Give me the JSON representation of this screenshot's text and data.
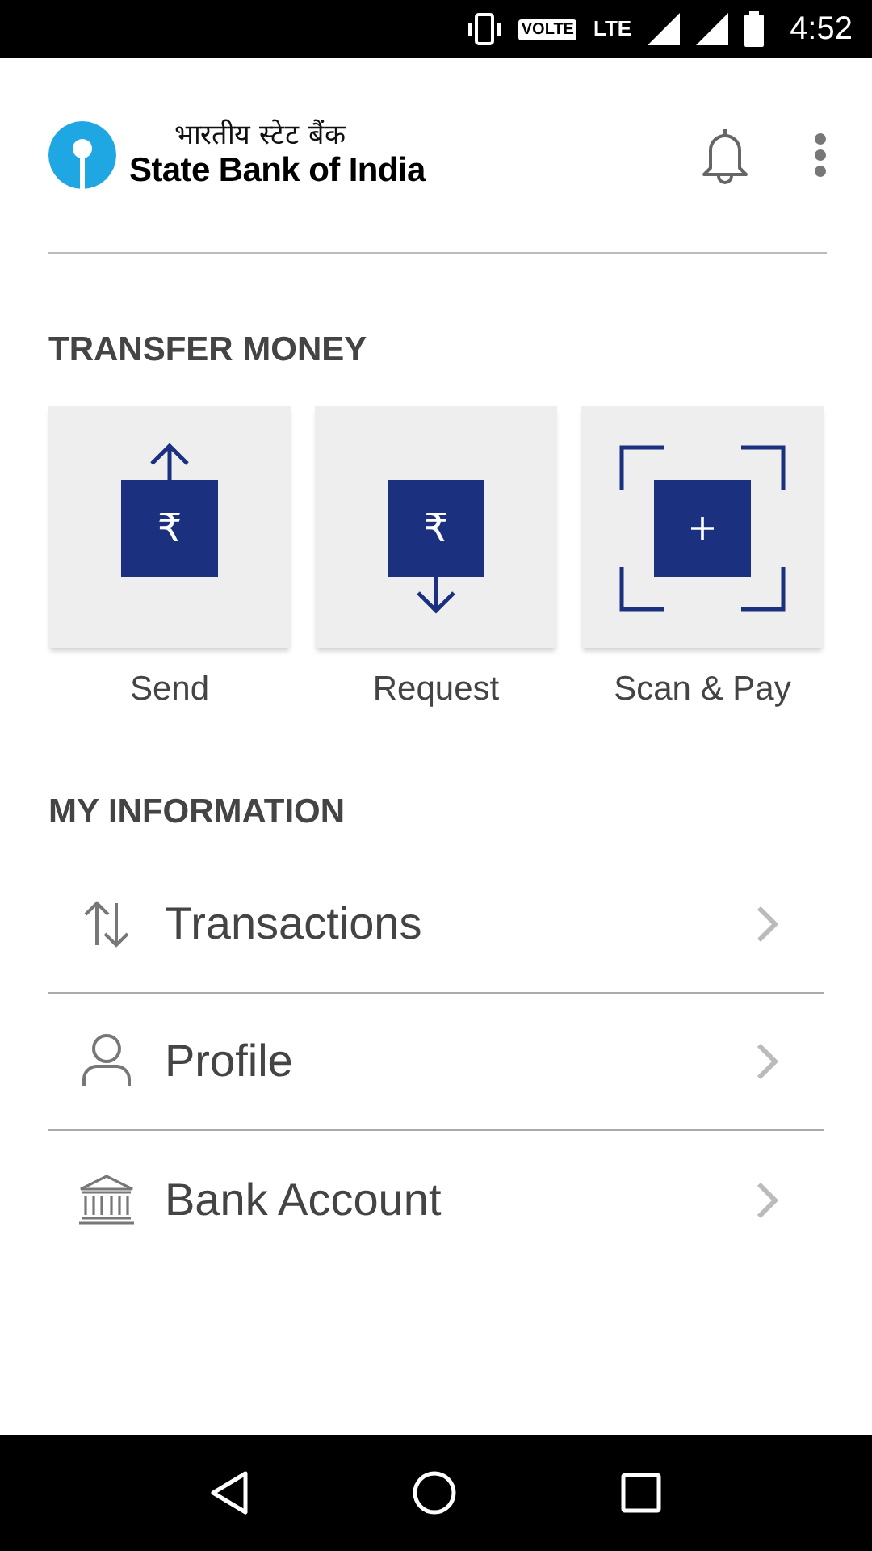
{
  "status_bar": {
    "network_badge": "VOLTE",
    "network_type": "LTE",
    "time": "4:52"
  },
  "header": {
    "logo_hindi": "भारतीय स्टेट बैंक",
    "logo_english": "State Bank of India"
  },
  "transfer_money": {
    "title": "TRANSFER MONEY",
    "actions": [
      {
        "kind": "send",
        "symbol": "₹",
        "label": "Send"
      },
      {
        "kind": "request",
        "symbol": "₹",
        "label": "Request"
      },
      {
        "kind": "scan",
        "label": "Scan & Pay"
      }
    ]
  },
  "my_information": {
    "title": "MY INFORMATION",
    "items": [
      {
        "kind": "transactions",
        "label": "Transactions"
      },
      {
        "kind": "profile",
        "label": "Profile"
      },
      {
        "kind": "bank",
        "label": "Bank Account"
      }
    ]
  }
}
